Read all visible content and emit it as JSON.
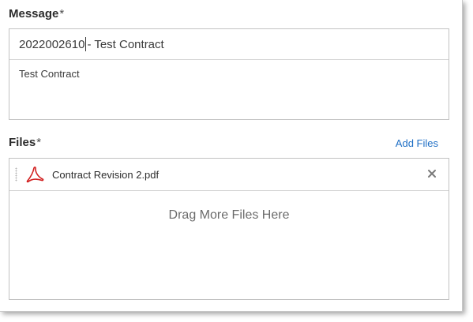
{
  "message": {
    "label": "Message",
    "required_mark": "*",
    "subject_before_caret": "2022002610",
    "subject_after_caret": " - Test Contract",
    "body": "Test Contract"
  },
  "files": {
    "label": "Files",
    "required_mark": "*",
    "add_files_label": "Add Files",
    "items": [
      {
        "name": "Contract Revision 2.pdf",
        "icon": "pdf-icon"
      }
    ],
    "drop_zone_text": "Drag More Files Here"
  },
  "colors": {
    "link": "#1f6fc5",
    "pdf_red": "#d21f1f"
  }
}
